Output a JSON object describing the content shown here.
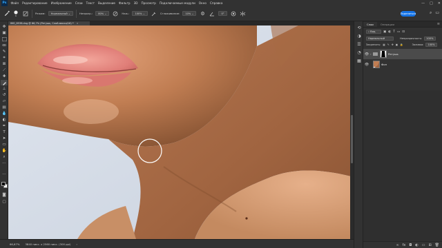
{
  "app": {
    "logo": "Ps"
  },
  "menu": [
    "Файл",
    "Редактирование",
    "Изображение",
    "Слои",
    "Текст",
    "Выделение",
    "Фильтр",
    "3D",
    "Просмотр",
    "Подключаемые модули",
    "Окно",
    "Справка"
  ],
  "options": {
    "brush_size": "6",
    "mode_label": "Режим:",
    "mode_value": "Нормальный",
    "opacity_label": "Непрозр.:",
    "opacity_value": "80%",
    "flow_label": "Наж.:",
    "flow_value": "100%",
    "smoothing_label": "Сглаживание:",
    "smoothing_value": "10%",
    "angle_value": "0°",
    "share_label": "Поделиться"
  },
  "document": {
    "tab_title": "IMG_8538.dng @ 66,7% (Ретушь, Слой-маска/16) *",
    "close": "×"
  },
  "status": {
    "zoom": "66,67%",
    "doc_info": "3840 пикс. x 2560 пикс. (300 ppi)",
    "arrow": "›"
  },
  "layers_panel": {
    "tabs": [
      "Слои",
      "Операции"
    ],
    "kind_filter": "Вид",
    "blend_mode": "Нормальный",
    "opacity_label": "Непрозрачность:",
    "opacity_value": "100%",
    "lock_label": "Закрепить:",
    "fill_label": "Заливка:",
    "fill_value": "100%",
    "layers": [
      {
        "name": "Ретушь",
        "type": "group",
        "selected": true
      },
      {
        "name": "Фон",
        "type": "image",
        "selected": false
      }
    ]
  },
  "colors": {
    "accent": "#1473e6",
    "panel_bg": "#323232",
    "app_bg": "#282828",
    "selected_layer": "#4b4b4b"
  },
  "icons": {
    "tools": [
      "move-icon",
      "artboard-icon",
      "marquee-icon",
      "lasso-icon",
      "quick-select-icon",
      "crop-icon",
      "frame-icon",
      "eyedropper-icon",
      "spot-heal-icon",
      "brush-icon",
      "clone-stamp-icon",
      "history-brush-icon",
      "eraser-icon",
      "gradient-icon",
      "blur-icon",
      "dodge-icon",
      "pen-icon",
      "type-icon",
      "path-select-icon",
      "rectangle-icon",
      "hand-icon",
      "zoom-icon"
    ]
  }
}
